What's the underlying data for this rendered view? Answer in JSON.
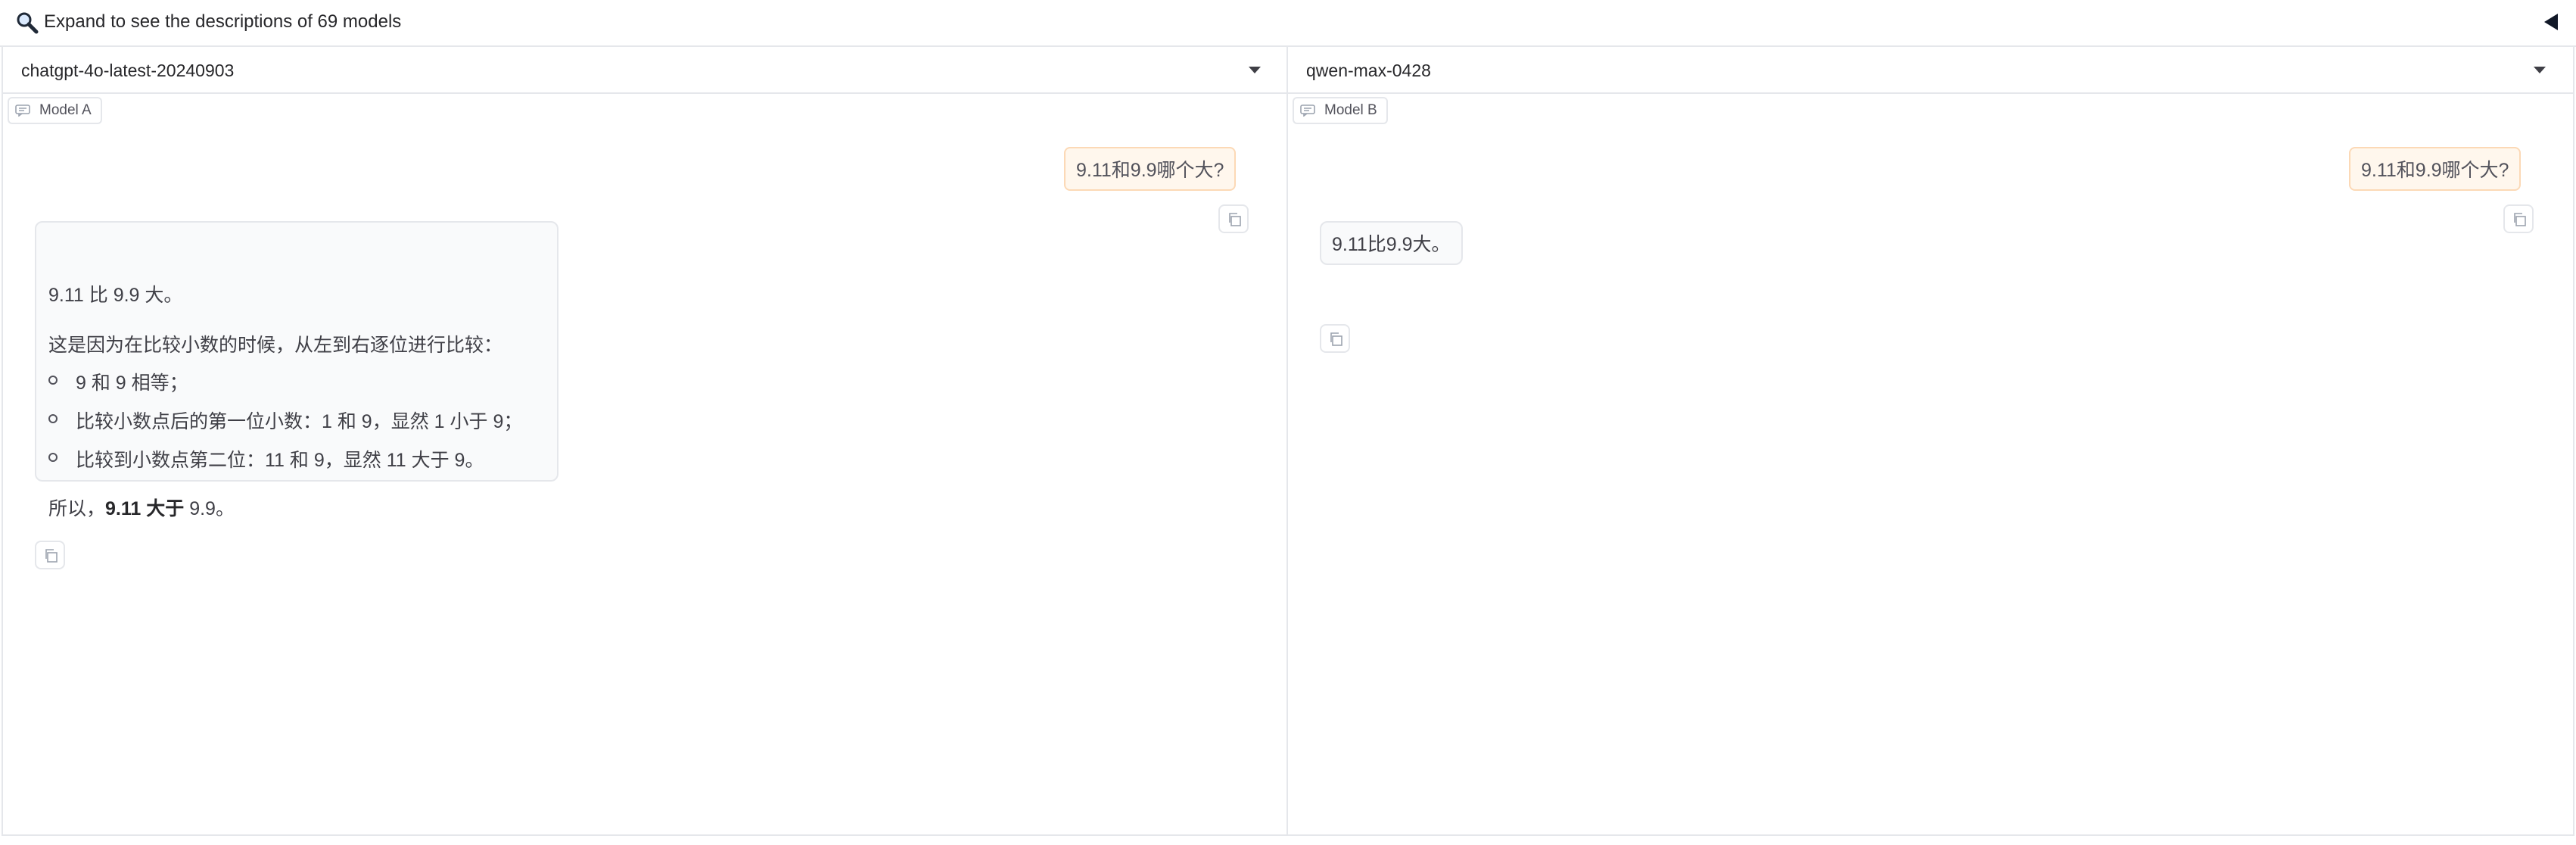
{
  "accordion": {
    "label": "Expand to see the descriptions of 69 models",
    "icon": "magnifier-icon",
    "toggle_icon": "triangle-left-icon"
  },
  "panel_a": {
    "model_select": "chatgpt-4o-latest-20240903",
    "chip_label": "Model A",
    "user_message": "9.11和9.9哪个大?",
    "response": {
      "line1": "9.11 比 9.9 大。",
      "line2": "这是因为在比较小数的时候，从左到右逐位进行比较：",
      "bullets": [
        "9 和 9 相等；",
        "比较小数点后的第一位小数：1 和 9，显然 1 小于 9；",
        "比较到小数点第二位：11 和 9，显然 11 大于 9。"
      ],
      "conclusion_prefix": "所以，",
      "conclusion_bold": "9.11 大于",
      "conclusion_suffix": " 9.9。"
    }
  },
  "panel_b": {
    "model_select": "qwen-max-0428",
    "chip_label": "Model B",
    "user_message": "9.11和9.9哪个大?",
    "response": "9.11比9.9大。"
  },
  "colors": {
    "user_bubble_bg": "#fff7ed",
    "user_bubble_border": "#fcd9b6",
    "bot_bubble_bg": "#f9fafb",
    "border": "#e5e7eb"
  }
}
